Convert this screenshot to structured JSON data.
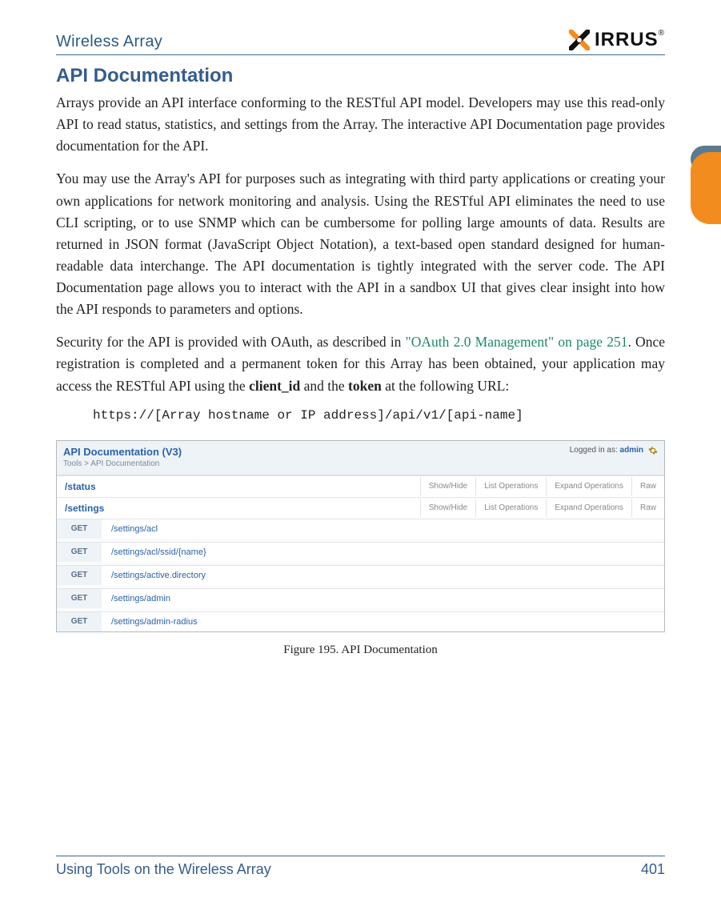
{
  "header": {
    "title": "Wireless Array",
    "logo_text": "RRUS"
  },
  "side_tab": {
    "color": "#f28c1e"
  },
  "section": {
    "heading": "API Documentation"
  },
  "paragraphs": {
    "p1": "Arrays provide an API interface conforming to the RESTful API model. Developers may use this read-only API to read status, statistics, and settings from the Array. The interactive API Documentation page provides documentation for the API.",
    "p2": "You may use the Array's API for purposes such as integrating with third party applications or creating your own applications for network monitoring and analysis. Using the RESTful API eliminates the need to use CLI scripting, or to use SNMP which can be cumbersome for polling large amounts of data. Results are returned in JSON format (JavaScript Object Notation), a text-based open standard designed for human-readable data interchange. The API documentation is tightly integrated with the server code. The API Documentation page allows you to interact with the API in a sandbox UI that gives clear insight into how the API responds to parameters and options.",
    "p3_a": "Security for the API is provided with OAuth, as described in ",
    "p3_link": "\"OAuth 2.0 Management\" on page 251",
    "p3_b": ". Once registration is completed and a permanent token for this Array has been obtained, your application may access the RESTful API using the ",
    "p3_bold1": "client_id",
    "p3_c": " and the ",
    "p3_bold2": "token",
    "p3_d": " at the following URL:"
  },
  "url_line": "https://[Array hostname or IP address]/api/v1/[api-name]",
  "embed": {
    "title": "API Documentation (V3)",
    "crumb": "Tools > API Documentation",
    "login_prefix": "Logged in as: ",
    "login_user": "admin",
    "ops": {
      "showhide": "Show/Hide",
      "list": "List Operations",
      "expand": "Expand Operations",
      "raw": "Raw"
    },
    "sections": [
      {
        "name": "/status",
        "expanded": false
      },
      {
        "name": "/settings",
        "expanded": true
      }
    ],
    "settings_rows": [
      {
        "method": "GET",
        "path": "/settings/acl"
      },
      {
        "method": "GET",
        "path": "/settings/acl/ssid/{name}"
      },
      {
        "method": "GET",
        "path": "/settings/active.directory"
      },
      {
        "method": "GET",
        "path": "/settings/admin"
      },
      {
        "method": "GET",
        "path": "/settings/admin-radius"
      }
    ]
  },
  "figure_caption": "Figure 195. API Documentation",
  "footer": {
    "left": "Using Tools on the Wireless Array",
    "page": "401"
  }
}
